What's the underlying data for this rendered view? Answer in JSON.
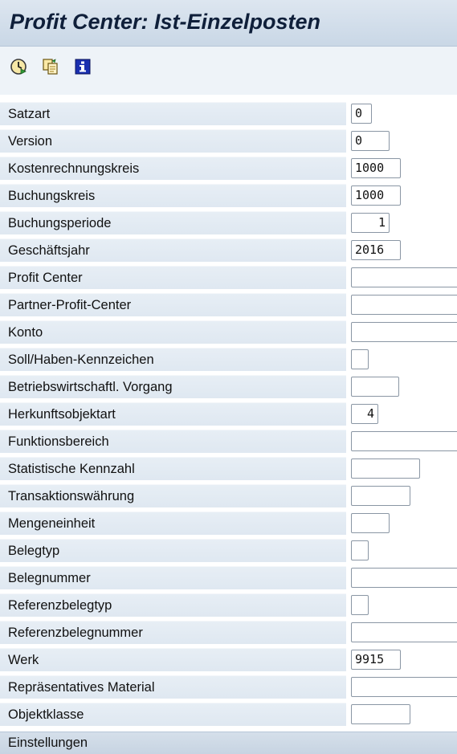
{
  "title": "Profit Center: Ist-Einzelposten",
  "toolbar": {
    "icons": [
      "execute-icon",
      "copy-icon",
      "info-icon"
    ]
  },
  "fields": [
    {
      "label": "Satzart",
      "value": "0",
      "align": "left"
    },
    {
      "label": "Version",
      "value": "0",
      "align": "left"
    },
    {
      "label": "Kostenrechnungskreis",
      "value": "1000",
      "align": "left"
    },
    {
      "label": "Buchungskreis",
      "value": "1000",
      "align": "left"
    },
    {
      "label": "Buchungsperiode",
      "value": "1",
      "align": "right"
    },
    {
      "label": "Geschäftsjahr",
      "value": "2016",
      "align": "left"
    },
    {
      "label": "Profit Center",
      "value": "",
      "align": "left"
    },
    {
      "label": "Partner-Profit-Center",
      "value": "",
      "align": "left"
    },
    {
      "label": "Konto",
      "value": "",
      "align": "left"
    },
    {
      "label": "Soll/Haben-Kennzeichen",
      "value": "",
      "align": "left"
    },
    {
      "label": "Betriebswirtschaftl. Vorgang",
      "value": "",
      "align": "left"
    },
    {
      "label": "Herkunftsobjektart",
      "value": "4",
      "align": "right"
    },
    {
      "label": "Funktionsbereich",
      "value": "",
      "align": "left"
    },
    {
      "label": "Statistische Kennzahl",
      "value": "",
      "align": "left"
    },
    {
      "label": "Transaktionswährung",
      "value": "",
      "align": "left"
    },
    {
      "label": "Mengeneinheit",
      "value": "",
      "align": "left"
    },
    {
      "label": "Belegtyp",
      "value": "",
      "align": "left"
    },
    {
      "label": "Belegnummer",
      "value": "",
      "align": "left"
    },
    {
      "label": "Referenzbelegtyp",
      "value": "",
      "align": "left"
    },
    {
      "label": "Referenzbelegnummer",
      "value": "",
      "align": "left"
    },
    {
      "label": "Werk",
      "value": "9915",
      "align": "left"
    },
    {
      "label": "Repräsentatives Material",
      "value": "",
      "align": "left"
    },
    {
      "label": "Objektklasse",
      "value": "",
      "align": "left"
    }
  ],
  "footer": {
    "label": "Einstellungen"
  }
}
